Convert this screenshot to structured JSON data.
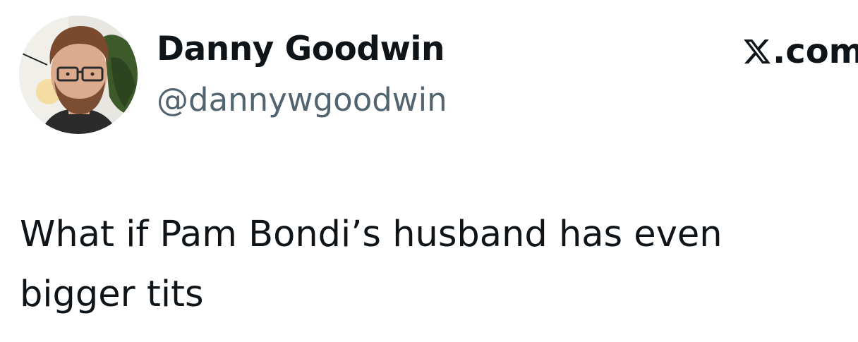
{
  "author": {
    "display_name": "Danny Goodwin",
    "handle": "@dannywgoodwin",
    "avatar_icon": "profile-photo"
  },
  "brand": {
    "logo_icon": "x-logo-icon",
    "domain": ".com"
  },
  "tweet": {
    "text": "What if Pam Bondi’s husband has even bigger tits"
  },
  "colors": {
    "name": "#0f1419",
    "handle": "#536471",
    "background": "#ffffff"
  }
}
